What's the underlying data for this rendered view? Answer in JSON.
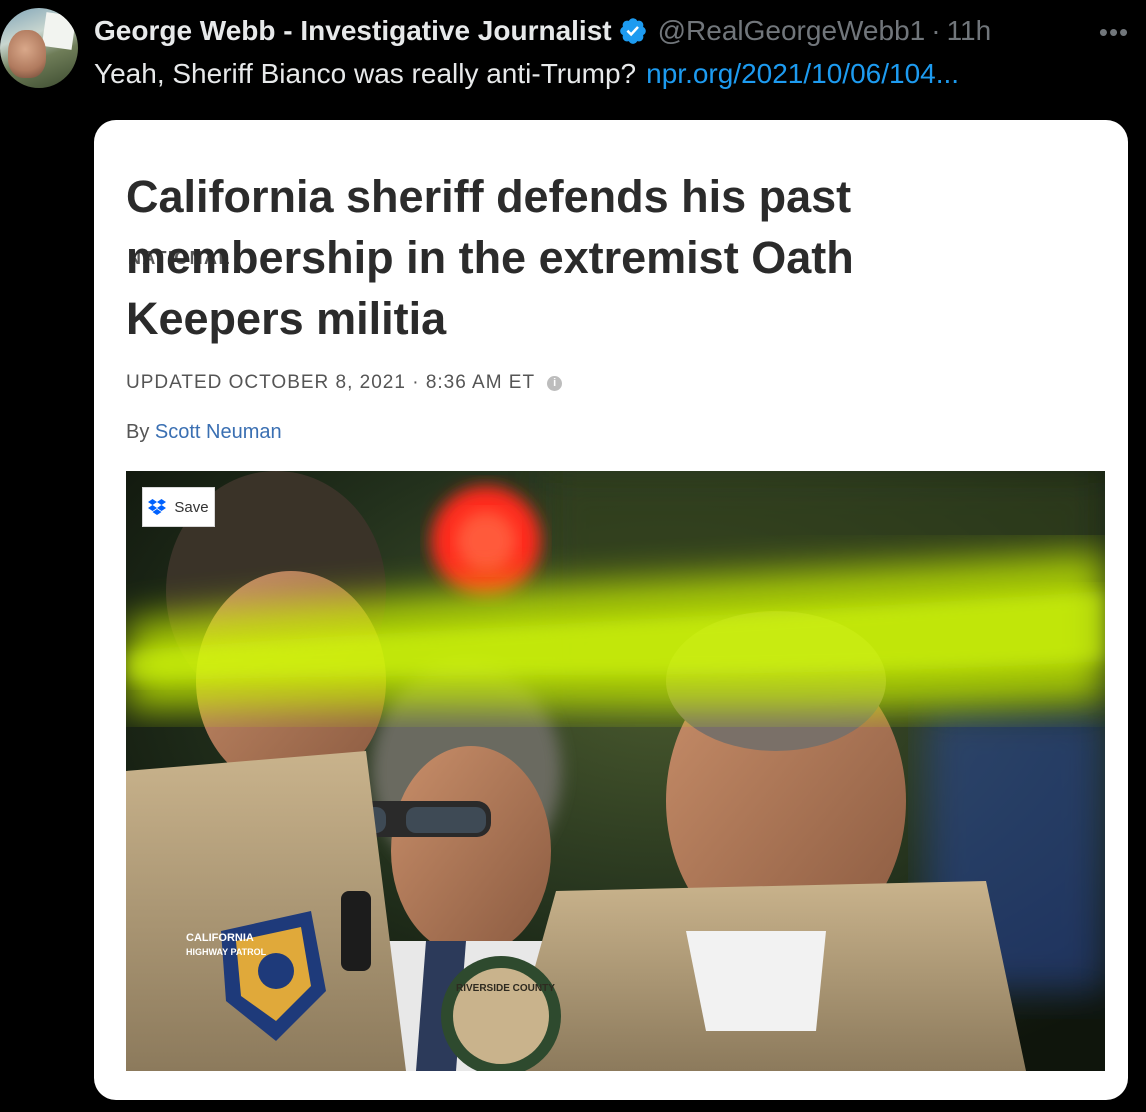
{
  "tweet": {
    "author_name": "George Webb - Investigative Journalist",
    "handle": "@RealGeorgeWebb1",
    "separator": "·",
    "time": "11h",
    "text": "Yeah, Sheriff Bianco was really anti-Trump?",
    "link_text": "npr.org/2021/10/06/104...",
    "more_label": "•••",
    "verified": true
  },
  "card": {
    "kicker": "NATIONAL",
    "headline": "California sheriff defends his past membership in the extremist Oath Keepers militia",
    "updated": "UPDATED OCTOBER 8, 2021 · 8:36 AM ET",
    "info_glyph": "i",
    "by_label": "By",
    "author": "Scott Neuman",
    "save_label": "Save"
  },
  "photo": {
    "patch_text_top": "CALIFORNIA",
    "patch_text_bottom": "HIGHWAY PATROL",
    "shoulder_patch_text": "RIVERSIDE COUNTY"
  },
  "colors": {
    "background": "#000000",
    "text_primary": "#e7e9ea",
    "text_secondary": "#71767b",
    "link": "#1d9bf0",
    "verified_badge": "#1d9bf0",
    "card_bg": "#ffffff",
    "headline": "#2b2b2b",
    "author_link": "#3a6fb2"
  },
  "icons": {
    "verified": "verified-badge-icon",
    "more": "more-options-icon",
    "info": "info-icon",
    "save": "dropbox-save-icon"
  }
}
